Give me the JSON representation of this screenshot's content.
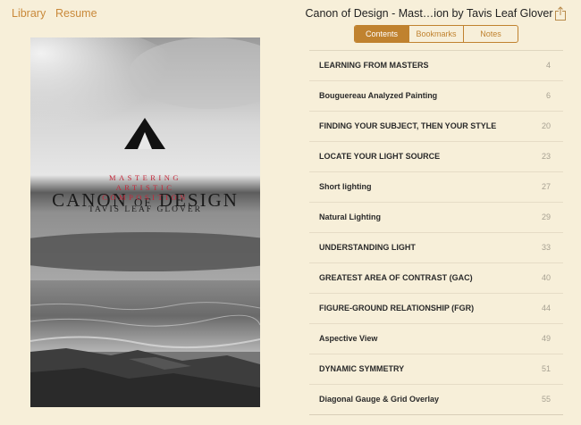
{
  "topbar": {
    "library": "Library",
    "resume": "Resume",
    "title": "Canon of Design - Mast…ion by Tavis Leaf Glover",
    "share_icon": "share-icon"
  },
  "tabs": [
    {
      "label": "Contents",
      "active": true
    },
    {
      "label": "Bookmarks",
      "active": false
    },
    {
      "label": "Notes",
      "active": false
    }
  ],
  "cover": {
    "title_a": "CANON",
    "title_of": "OF",
    "title_b": "DESIGN",
    "subtitle_1": "MASTERING",
    "subtitle_2": "ARTISTIC",
    "subtitle_3": "COMPOSITION",
    "author": "TAVIS LEAF GLOVER"
  },
  "contents": [
    {
      "title": "LEARNING FROM MASTERS",
      "page": "4"
    },
    {
      "title": "Bouguereau Analyzed Painting",
      "page": "6"
    },
    {
      "title": "FINDING YOUR SUBJECT, THEN YOUR STYLE",
      "page": "20"
    },
    {
      "title": "LOCATE YOUR LIGHT SOURCE",
      "page": "23"
    },
    {
      "title": "Short lighting",
      "page": "27"
    },
    {
      "title": "Natural Lighting",
      "page": "29"
    },
    {
      "title": "UNDERSTANDING LIGHT",
      "page": "33"
    },
    {
      "title": "GREATEST AREA OF CONTRAST (GAC)",
      "page": "40"
    },
    {
      "title": "FIGURE-GROUND RELATIONSHIP (FGR)",
      "page": "44"
    },
    {
      "title": "Aspective View",
      "page": "49"
    },
    {
      "title": "DYNAMIC SYMMETRY",
      "page": "51"
    },
    {
      "title": "Diagonal Gauge & Grid Overlay",
      "page": "55"
    }
  ],
  "colors": {
    "background": "#f7efd9",
    "accent": "#c0822f",
    "cover_red": "#c4283a"
  }
}
